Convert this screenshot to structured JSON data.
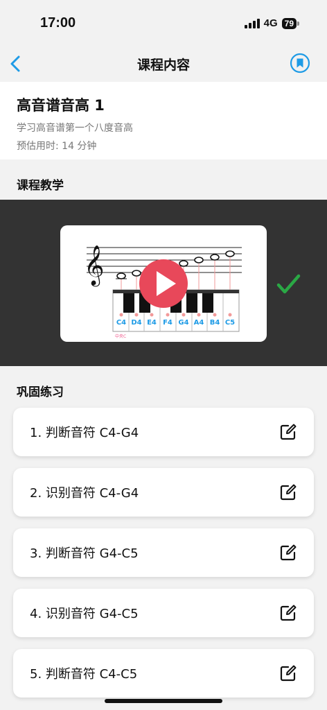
{
  "status": {
    "time": "17:00",
    "network": "4G",
    "battery": "79"
  },
  "nav": {
    "title": "课程内容"
  },
  "course": {
    "title": "高音谱音高 1",
    "subtitle": "学习高音谱第一个八度音高",
    "duration": "预估用时: 14 分钟"
  },
  "lesson": {
    "section_title": "课程教学",
    "keys": [
      "C4",
      "D4",
      "E4",
      "F4",
      "G4",
      "A4",
      "B4",
      "C5"
    ],
    "middle_c_label": "中央C",
    "completed": true
  },
  "practice": {
    "section_title": "巩固练习",
    "items": [
      {
        "label": "1. 判断音符 C4-G4"
      },
      {
        "label": "2. 识别音符 C4-G4"
      },
      {
        "label": "3. 判断音符 G4-C5"
      },
      {
        "label": "4. 识别音符 G4-C5"
      },
      {
        "label": "5. 判断音符 C4-C5"
      }
    ]
  },
  "colors": {
    "accent": "#1e9be6",
    "play": "#e8485a",
    "check": "#2aa845",
    "key_label": "#1e9be6"
  }
}
